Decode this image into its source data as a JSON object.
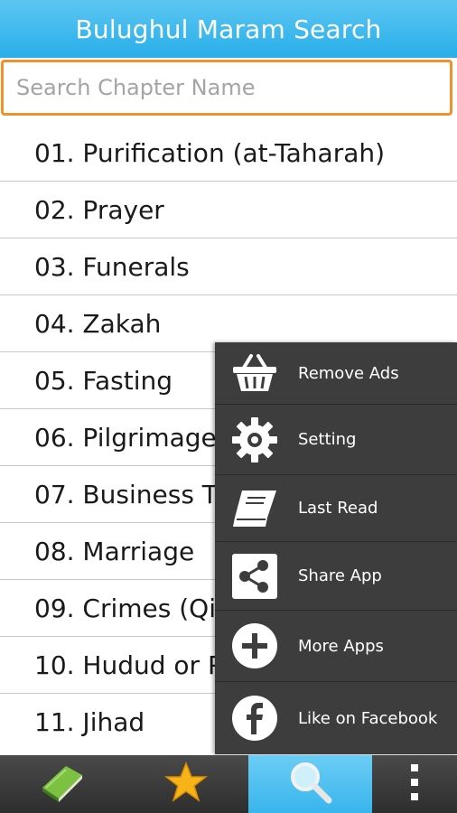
{
  "app": {
    "title": "Bulughul Maram Search"
  },
  "search": {
    "placeholder": "Search Chapter Name",
    "value": ""
  },
  "chapters": [
    "01. Purification (at-Taharah)",
    "02. Prayer",
    "03. Funerals",
    "04. Zakah",
    "05. Fasting",
    "06. Pilgrimage",
    "07. Business T",
    "08. Marriage",
    "09. Crimes (Qi",
    "10. Hudud or P",
    "11. Jihad"
  ],
  "menu": {
    "items": [
      {
        "label": "Remove Ads",
        "icon": "basket-icon"
      },
      {
        "label": "Setting",
        "icon": "gear-icon"
      },
      {
        "label": "Last Read",
        "icon": "book-icon"
      },
      {
        "label": "Share App",
        "icon": "share-icon"
      },
      {
        "label": "More Apps",
        "icon": "plus-circle-icon"
      },
      {
        "label": "Like on Facebook",
        "icon": "facebook-icon"
      }
    ]
  },
  "bottom_nav": {
    "tabs": [
      {
        "icon": "book-icon",
        "active": false
      },
      {
        "icon": "star-icon",
        "active": false
      },
      {
        "icon": "search-icon",
        "active": true
      },
      {
        "icon": "overflow-menu-icon",
        "active": false
      }
    ]
  },
  "colors": {
    "accent": "#29aee9",
    "search_border": "#f0922c",
    "menu_bg": "#3d3d3d"
  }
}
